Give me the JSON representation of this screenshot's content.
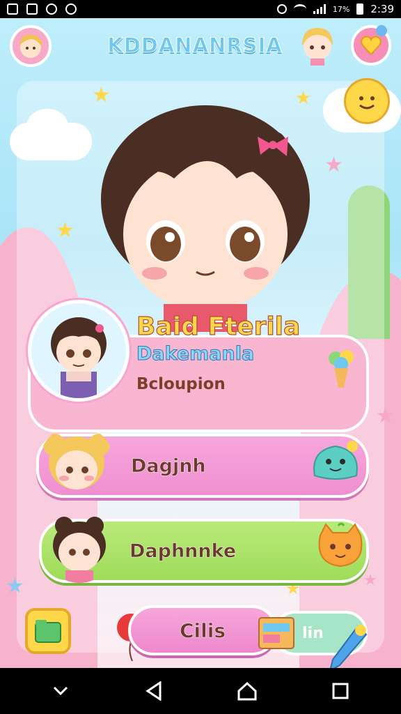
{
  "status_bar": {
    "time": "2:39",
    "battery": "17%",
    "icons": [
      "image-icon",
      "photo-icon",
      "instagram-icon",
      "messenger-icon"
    ]
  },
  "header": {
    "title": "KDDANANRSIA",
    "left_avatar": "girl-avatar-icon",
    "right_avatar": "blonde-girl-avatar-icon",
    "heart_button": "heart-icon"
  },
  "profile": {
    "name": "Baid Fterila",
    "subtitle": "Dakemanla",
    "description": "Bcloupion"
  },
  "list": {
    "items": [
      {
        "label": "Dagjnh",
        "icon": "slime-monster-icon"
      },
      {
        "label": "Daphnnke",
        "icon": "orange-cat-icon"
      }
    ]
  },
  "toolbar": {
    "left_icon": "folder-icon",
    "main_label": "Cilis",
    "right_label": "lin",
    "balloon": "balloon-icon",
    "book": "book-icon",
    "pencil": "pencil-icon"
  },
  "navbar": {
    "items": [
      "back-icon",
      "home-icon",
      "recents-icon",
      "chevron-down-icon"
    ]
  },
  "colors": {
    "sky": "#bfeefb",
    "pink_row": "#f7a6dd",
    "green_row": "#a9e068",
    "title_blue": "#6fc8ef",
    "gold": "#ffd94a"
  }
}
